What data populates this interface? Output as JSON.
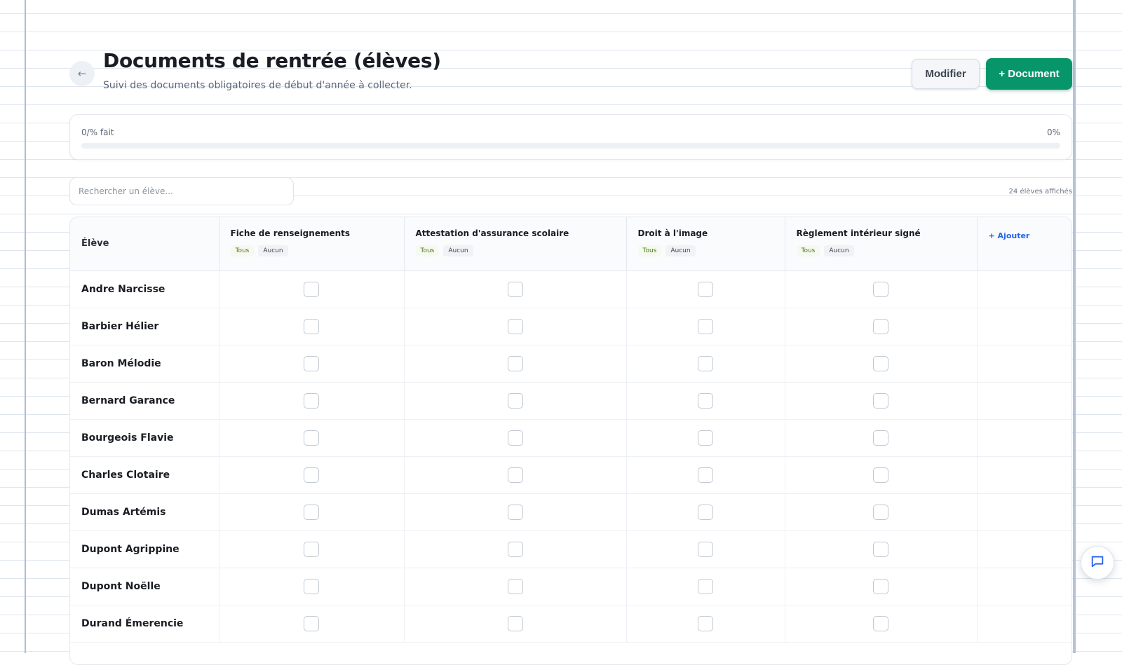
{
  "header": {
    "back_icon": "arrow-left-icon",
    "title": "Documents de rentrée (élèves)",
    "subtitle": "Suivi des documents obligatoires de début d'année à collecter.",
    "modify_label": "Modifier",
    "add_document_label": "+ Document"
  },
  "progress": {
    "label": "0/% fait",
    "percent_label": "0%",
    "fraction": 0
  },
  "search": {
    "placeholder": "Rechercher un élève...",
    "value": ""
  },
  "student_count_label": "24 élèves affichés",
  "table": {
    "student_header": "Élève",
    "documents": [
      {
        "title": "Fiche de renseignements",
        "all_label": "Tous",
        "none_label": "Aucun"
      },
      {
        "title": "Attestation d'assurance scolaire",
        "all_label": "Tous",
        "none_label": "Aucun"
      },
      {
        "title": "Droit à l'image",
        "all_label": "Tous",
        "none_label": "Aucun"
      },
      {
        "title": "Règlement intérieur signé",
        "all_label": "Tous",
        "none_label": "Aucun"
      }
    ],
    "add_column_label": "+ Ajouter",
    "students": [
      "Andre Narcisse",
      "Barbier Hélier",
      "Baron Mélodie",
      "Bernard Garance",
      "Bourgeois Flavie",
      "Charles Clotaire",
      "Dumas Artémis",
      "Dupont Agrippine",
      "Dupont Noëlle",
      "Durand Émerencie"
    ]
  },
  "colors": {
    "accent": "#079669",
    "link": "#2563eb",
    "pill_all_text": "#4d7c0f",
    "margin_line": "#a9bfd6"
  },
  "chat": {
    "icon": "chat-bubble-icon"
  }
}
